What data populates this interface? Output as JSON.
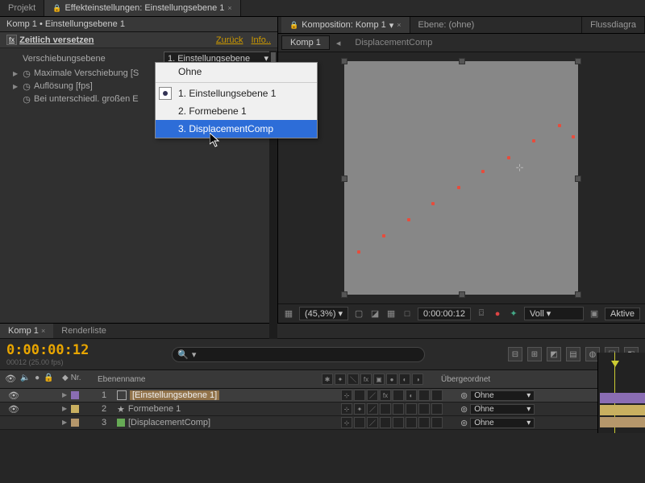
{
  "top_tabs": {
    "projekt": "Projekt",
    "effekt": "Effekteinstellungen: Einstellungsebene 1",
    "komp_tab": "Komposition: Komp 1",
    "ebene_tab": "Ebene: (ohne)",
    "fluss_tab": "Flussdiagra"
  },
  "breadcrumb": "Komp 1 • Einstellungsebene 1",
  "effect": {
    "name": "Zeitlich versetzen",
    "reset": "Zurück",
    "info": "Info..",
    "props": {
      "layer": "Verschiebungsebene",
      "layer_val": "1. Einstellungsebene",
      "max": "Maximale Verschiebung [S",
      "aufl": "Auflösung [fps]",
      "bei": "Bei unterschiedl. großen E"
    }
  },
  "dropdown": {
    "none": "Ohne",
    "opt1": "1. Einstellungsebene 1",
    "opt2": "2. Formebene 1",
    "opt3": "3. DisplacementComp"
  },
  "viewport": {
    "tabs": {
      "komp": "Komp 1",
      "disp": "DisplacementComp"
    },
    "footer": {
      "zoom": "(45,3%)",
      "time": "0:00:00:12",
      "res": "Voll",
      "aktiv": "Aktive"
    }
  },
  "timeline": {
    "tabs": {
      "komp": "Komp 1",
      "render": "Renderliste"
    },
    "timecode": "0:00:00:12",
    "fps": "00012 (25.00 fps)",
    "cols": {
      "nr": "Nr.",
      "name": "Ebenenname",
      "parent": "Übergeordnet"
    },
    "layers": {
      "l1": {
        "n": "1",
        "name": "[Einstellungsebene 1]",
        "parent": "Ohne"
      },
      "l2": {
        "n": "2",
        "name": "Formebene 1",
        "parent": "Ohne"
      },
      "l3": {
        "n": "3",
        "name": "[DisplacementComp]",
        "parent": "Ohne"
      }
    }
  }
}
